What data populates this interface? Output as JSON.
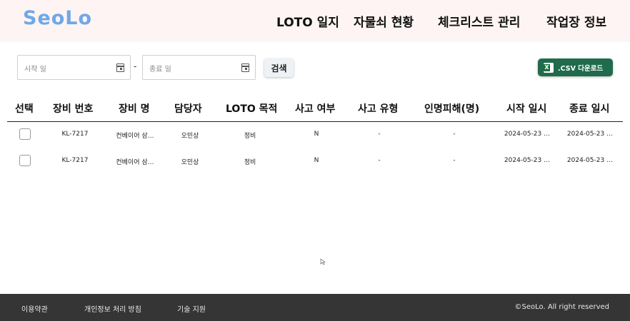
{
  "header": {
    "logo": "SeoLo",
    "nav": [
      "LOTO 일지",
      "자물쇠 현황",
      "체크리스트 관리",
      "작업장 정보"
    ]
  },
  "filters": {
    "start_placeholder": "시작 일",
    "end_placeholder": "종료 일",
    "separator": "-",
    "search_label": "검색",
    "csv_label": ".CSV 다운로드"
  },
  "table": {
    "columns": [
      "선택",
      "장비 번호",
      "장비 명",
      "담당자",
      "LOTO 목적",
      "사고 여부",
      "사고 유형",
      "인명피해(명)",
      "시작 일시",
      "종료 일시"
    ],
    "rows": [
      [
        "KL-7217",
        "컨베이어 삼…",
        "오민상",
        "정비",
        "N",
        "-",
        "-",
        "2024-05-23 …",
        "2024-05-23 …"
      ],
      [
        "KL-7217",
        "컨베이어 삼…",
        "오민상",
        "정비",
        "N",
        "-",
        "-",
        "2024-05-23 …",
        "2024-05-23 …"
      ]
    ]
  },
  "footer": {
    "terms": "이용약관",
    "privacy": "개인정보 처리 방침",
    "support": "기술 지원",
    "copyright": "©SeoLo. All right reserved"
  },
  "colors": {
    "logo": "#6fa8e8",
    "header_bg": "#fdf4f3",
    "csv_button": "#1f6b4c",
    "footer_bg": "#353535"
  }
}
